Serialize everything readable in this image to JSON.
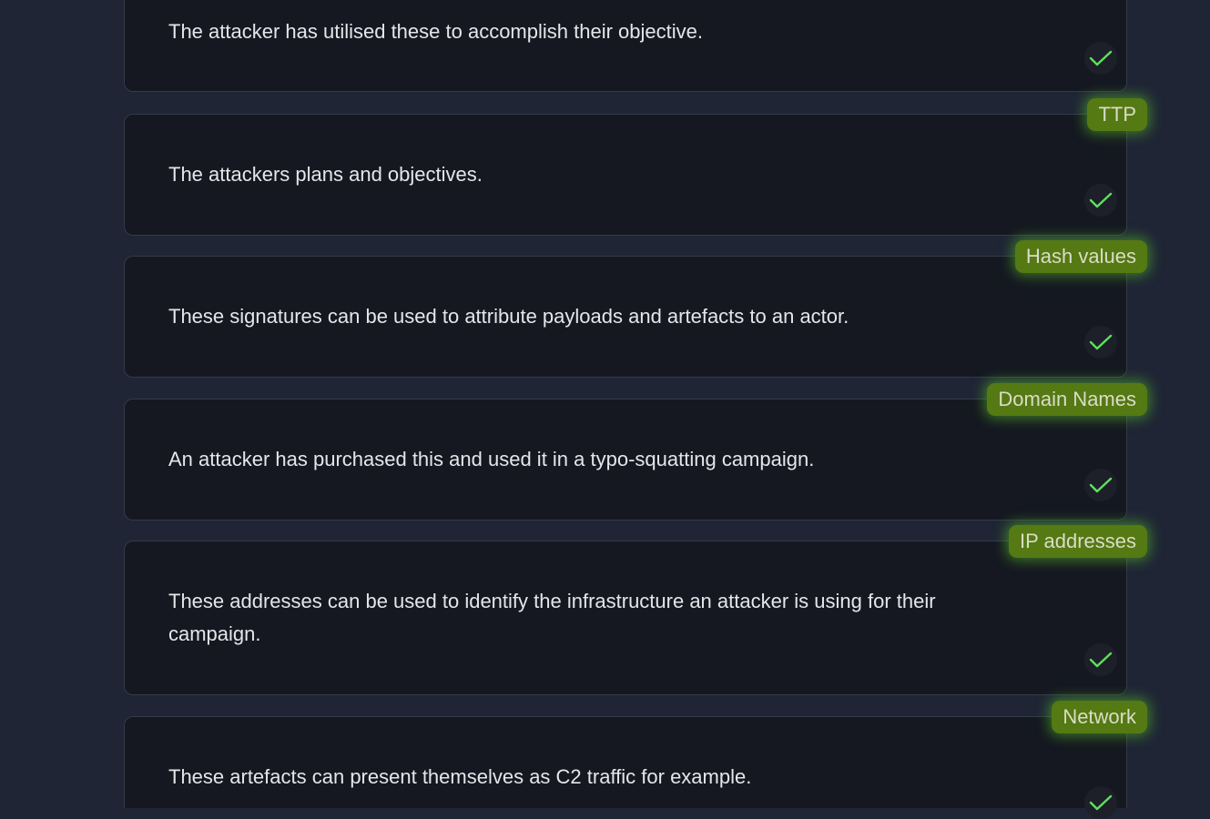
{
  "cards": [
    {
      "text": "The attacker has utilised these to accomplish their objective.",
      "check_icon": "checkmark-icon"
    },
    {
      "tag": "TTP",
      "text": "The attackers plans and objectives.",
      "check_icon": "checkmark-icon"
    },
    {
      "tag": "Hash values",
      "text": "These signatures can be used to attribute payloads and artefacts to an actor.",
      "check_icon": "checkmark-icon"
    },
    {
      "tag": "Domain Names",
      "text": "An attacker has purchased this and used it in a typo-squatting campaign.",
      "check_icon": "checkmark-icon"
    },
    {
      "tag": "IP addresses",
      "text": "These addresses can be used to identify the infrastructure an attacker is using for their campaign.",
      "check_icon": "checkmark-icon"
    },
    {
      "tag": "Network",
      "text": "These artefacts can present themselves as C2 traffic for example.",
      "check_icon": "checkmark-icon"
    }
  ],
  "colors": {
    "background": "#1f2535",
    "card": "#151821",
    "tag": "#557913",
    "check": "#5ee05e"
  }
}
